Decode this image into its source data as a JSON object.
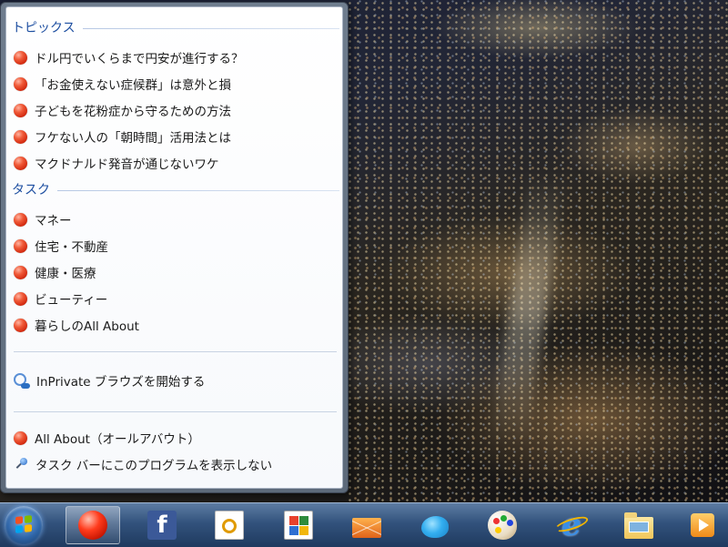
{
  "jumplist": {
    "topics": {
      "header": "トピックス",
      "items": [
        "ドル円でいくらまで円安が進行する？",
        "「お金使えない症候群」は意外と損",
        "子どもを花粉症から守るための方法",
        "フケない人の「朝時間」活用法とは",
        "マクドナルド発音が通じないワケ"
      ]
    },
    "tasks": {
      "header": "タスク",
      "items": [
        "マネー",
        "住宅・不動産",
        "健康・医療",
        "ビューティー",
        "暮らしのAll About"
      ]
    },
    "inprivate_label": "InPrivate ブラウズを開始する",
    "app_label": "All About（オールアバウト）",
    "unpin_label": "タスク バーにこのプログラムを表示しない",
    "accent_color": "#1e4fa1"
  },
  "taskbar": {
    "start_icon": "windows-start-orb",
    "buttons": [
      {
        "name": "allabout-taskbar-button",
        "icon": "red-ball-icon",
        "active": true
      },
      {
        "name": "facebook-taskbar-button",
        "icon": "facebook-icon",
        "glyph": "f"
      },
      {
        "name": "notes-taskbar-button",
        "icon": "notes-icon"
      },
      {
        "name": "photos-taskbar-button",
        "icon": "photo-gallery-icon"
      },
      {
        "name": "mail-taskbar-button",
        "icon": "mail-icon"
      },
      {
        "name": "twitter-taskbar-button",
        "icon": "twitter-bird-icon"
      },
      {
        "name": "paint-taskbar-button",
        "icon": "palette-icon"
      },
      {
        "name": "ie-taskbar-button",
        "icon": "internet-explorer-icon",
        "glyph": "e"
      },
      {
        "name": "explorer-taskbar-button",
        "icon": "folder-icon"
      },
      {
        "name": "media-taskbar-button",
        "icon": "media-player-icon"
      }
    ]
  }
}
